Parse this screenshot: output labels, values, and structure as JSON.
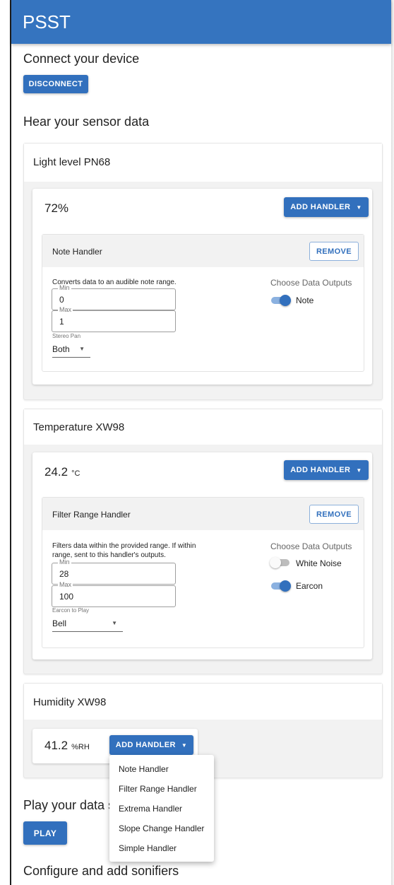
{
  "app": {
    "title": "PSST"
  },
  "connect": {
    "heading": "Connect your device",
    "button": "DISCONNECT"
  },
  "sensors_heading": "Hear your sensor data",
  "sensors": [
    {
      "name": "Light level PN68",
      "value": "72%",
      "unit": "",
      "add_handler": "ADD HANDLER",
      "handler": {
        "title": "Note Handler",
        "remove": "REMOVE",
        "description": "Converts data to an audible note range.",
        "min_label": "Min",
        "min_value": "0",
        "max_label": "Max",
        "max_value": "1",
        "select_label": "Stereo Pan",
        "select_value": "Both",
        "outputs_title": "Choose Data Outputs",
        "outputs": [
          {
            "label": "Note",
            "on": true
          }
        ]
      }
    },
    {
      "name": "Temperature XW98",
      "value": "24.2",
      "unit": "°C",
      "add_handler": "ADD HANDLER",
      "handler": {
        "title": "Filter Range Handler",
        "remove": "REMOVE",
        "description": "Filters data within the provided range. If within range, sent to this handler's outputs.",
        "min_label": "Min",
        "min_value": "28",
        "max_label": "Max",
        "max_value": "100",
        "select_label": "Earcon to Play",
        "select_value": "Bell",
        "outputs_title": "Choose Data Outputs",
        "outputs": [
          {
            "label": "White Noise",
            "on": false
          },
          {
            "label": "Earcon",
            "on": true
          }
        ]
      }
    },
    {
      "name": "Humidity XW98",
      "value": "41.2",
      "unit": "%RH",
      "add_handler": "ADD HANDLER"
    }
  ],
  "handler_menu": [
    "Note Handler",
    "Filter Range Handler",
    "Extrema Handler",
    "Slope Change Handler",
    "Simple Handler"
  ],
  "play": {
    "heading": "Play your data s",
    "button": "PLAY"
  },
  "configure_heading": "Configure and add sonifiers"
}
